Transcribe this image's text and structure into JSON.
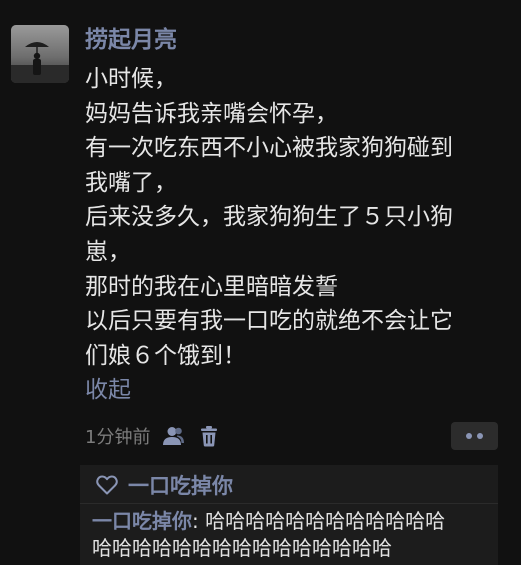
{
  "post": {
    "author": "捞起月亮",
    "lines": [
      "小时候，",
      "妈妈告诉我亲嘴会怀孕，",
      "有一次吃东西不小心被我家狗狗碰到",
      "我嘴了，",
      "后来没多久，我家狗狗生了５只小狗",
      "崽，",
      "那时的我在心里暗暗发誓",
      "以后只要有我一口吃的就绝不会让它",
      "们娘６个饿到！"
    ],
    "collapse_label": "收起",
    "time": "1分钟前",
    "icons": {
      "avatar": "avatar-photo",
      "user": "user-icon",
      "delete": "trash-icon",
      "more": "more-dots-icon",
      "like": "heart-icon"
    }
  },
  "likes": {
    "names": "一口吃掉你"
  },
  "comments": [
    {
      "user": "一口吃掉你",
      "separator": ": ",
      "text_line1": "哈哈哈哈哈哈哈哈哈哈哈哈",
      "text_line2": "哈哈哈哈哈哈哈哈哈哈哈哈哈哈哈"
    }
  ],
  "colors": {
    "background": "#111111",
    "name_link": "#7b87a8",
    "body_text": "#e6e6e6",
    "muted": "#7c7c7c",
    "panel": "#1c1c1c"
  }
}
